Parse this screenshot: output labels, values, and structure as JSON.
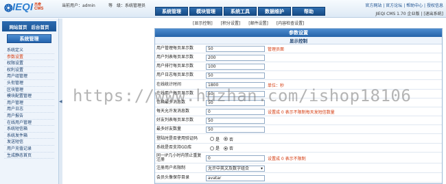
{
  "logo": {
    "symbol": "❂",
    "name": "IEQI",
    "sub": "杰奇",
    "cms": "CMS"
  },
  "userinfo": {
    "current_user": "当前用户：admin",
    "rank": "等　级：系统管理员"
  },
  "nav": {
    "tabs": [
      "系统管理",
      "模块管理",
      "系统工具",
      "数据维护",
      "帮助"
    ]
  },
  "toplinks": {
    "home": "官方网站",
    "forum": "官方论坛",
    "help": "帮助中心",
    "support": "授权信息"
  },
  "version": {
    "text": "JIEQI CMS 1.70 企业版",
    "logout": "[退出系统]"
  },
  "sidebar": {
    "shortcuts": [
      "网站首页",
      "后台首页"
    ],
    "section": "系统管理",
    "items": [
      "系统定义",
      "参数设置",
      "权限设置",
      "权利设置",
      "用户组管理",
      "头衔管理",
      "区块管理",
      "模块配置管理",
      "用户管理",
      "用户日志",
      "用户报告",
      "在线用户管理",
      "系统短信箱",
      "系统发件箱",
      "发送短信",
      "用户充值记录",
      "生成静态首页"
    ],
    "active_index": 1
  },
  "subtabs": [
    "[显示控制]",
    "[积分设置]",
    "[邮件设置]",
    "[内容检查设置]"
  ],
  "panel": {
    "title": "参数设置",
    "subtitle": "显示控制",
    "rows": [
      {
        "label": "用户管理每页显示数",
        "type": "input",
        "value": "50",
        "note": "管理员面"
      },
      {
        "label": "用户列表每页显示数",
        "type": "input",
        "value": "200",
        "note": ""
      },
      {
        "label": "用户排行每页显示数",
        "type": "input",
        "value": "100",
        "note": ""
      },
      {
        "label": "用户日志每页显示数",
        "type": "input",
        "value": "50",
        "note": ""
      },
      {
        "label": "在线统计时间",
        "type": "input",
        "value": "1800",
        "note": "单位：秒"
      },
      {
        "label": "在线用户每页显示数",
        "type": "input",
        "value": "50",
        "note": ""
      },
      {
        "label": "信箱最多消息数",
        "type": "input",
        "value": "50",
        "note": ""
      },
      {
        "label": "每天允许发消息数",
        "type": "input",
        "value": "0",
        "note": "设置成 0 表示不限制每天发短信数量"
      },
      {
        "label": "好友列表每页显示数",
        "type": "input",
        "value": "50",
        "note": ""
      },
      {
        "label": "最多好友数量",
        "type": "input",
        "value": "50",
        "note": ""
      },
      {
        "label": "登陆时是否使用验证码",
        "type": "radio",
        "options": [
          "是",
          "否"
        ],
        "selected": 1
      },
      {
        "label": "系统是否支持GD库",
        "type": "radio",
        "options": [
          "是",
          "否"
        ],
        "selected": 1
      },
      {
        "label": "同一IP几小时内禁止重复注册",
        "type": "input",
        "value": "0",
        "note": "设置成 0 表示不限制"
      },
      {
        "label": "注册用户名限制",
        "type": "select",
        "value": "允许中英文及数字组合"
      },
      {
        "label": "会员头像保存目录",
        "type": "input",
        "value": "avatar",
        "note": ""
      }
    ]
  },
  "watermark": "https://www.huzhan.com/ishop18106"
}
